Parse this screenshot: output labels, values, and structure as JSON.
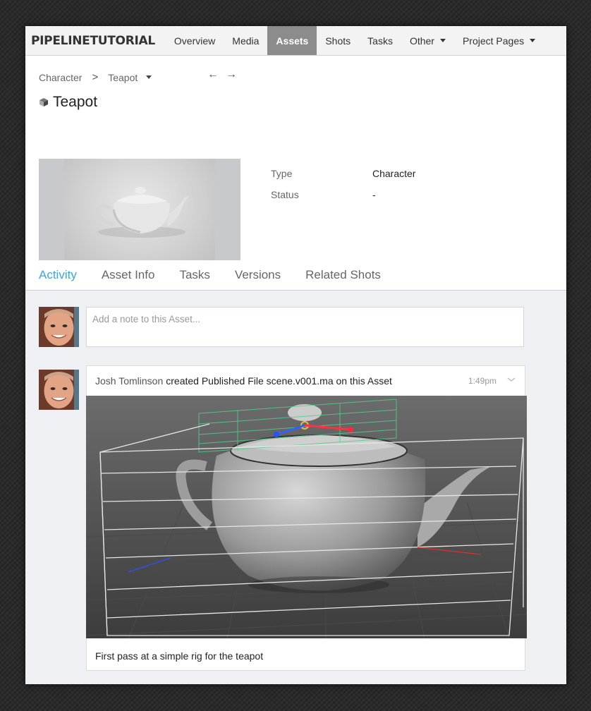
{
  "nav": {
    "brand": "PIPELINETUTORIAL",
    "items": [
      {
        "label": "Overview",
        "active": false,
        "dropdown": false
      },
      {
        "label": "Media",
        "active": false,
        "dropdown": false
      },
      {
        "label": "Assets",
        "active": true,
        "dropdown": false
      },
      {
        "label": "Shots",
        "active": false,
        "dropdown": false
      },
      {
        "label": "Tasks",
        "active": false,
        "dropdown": false
      },
      {
        "label": "Other",
        "active": false,
        "dropdown": true
      },
      {
        "label": "Project Pages",
        "active": false,
        "dropdown": true
      }
    ]
  },
  "breadcrumb": {
    "parent": "Character",
    "separator": ">",
    "current": "Teapot",
    "prev_icon": "←",
    "next_icon": "→"
  },
  "asset": {
    "title": "Teapot",
    "icon": "cube-icon",
    "fields": [
      {
        "label": "Type",
        "value": "Character"
      },
      {
        "label": "Status",
        "value": "-"
      }
    ]
  },
  "tabs": [
    {
      "label": "Activity",
      "active": true
    },
    {
      "label": "Asset Info",
      "active": false
    },
    {
      "label": "Tasks",
      "active": false
    },
    {
      "label": "Versions",
      "active": false
    },
    {
      "label": "Related Shots",
      "active": false
    }
  ],
  "note": {
    "placeholder": "Add a note to this Asset..."
  },
  "activity": {
    "user": "Josh Tomlinson",
    "action": "created Published File scene.v001.ma on this Asset",
    "time": "1:49pm",
    "caption": "First pass at a simple rig for the teapot"
  },
  "colors": {
    "accent": "#3aa6dd",
    "nav_active": "#8c8c8c"
  }
}
